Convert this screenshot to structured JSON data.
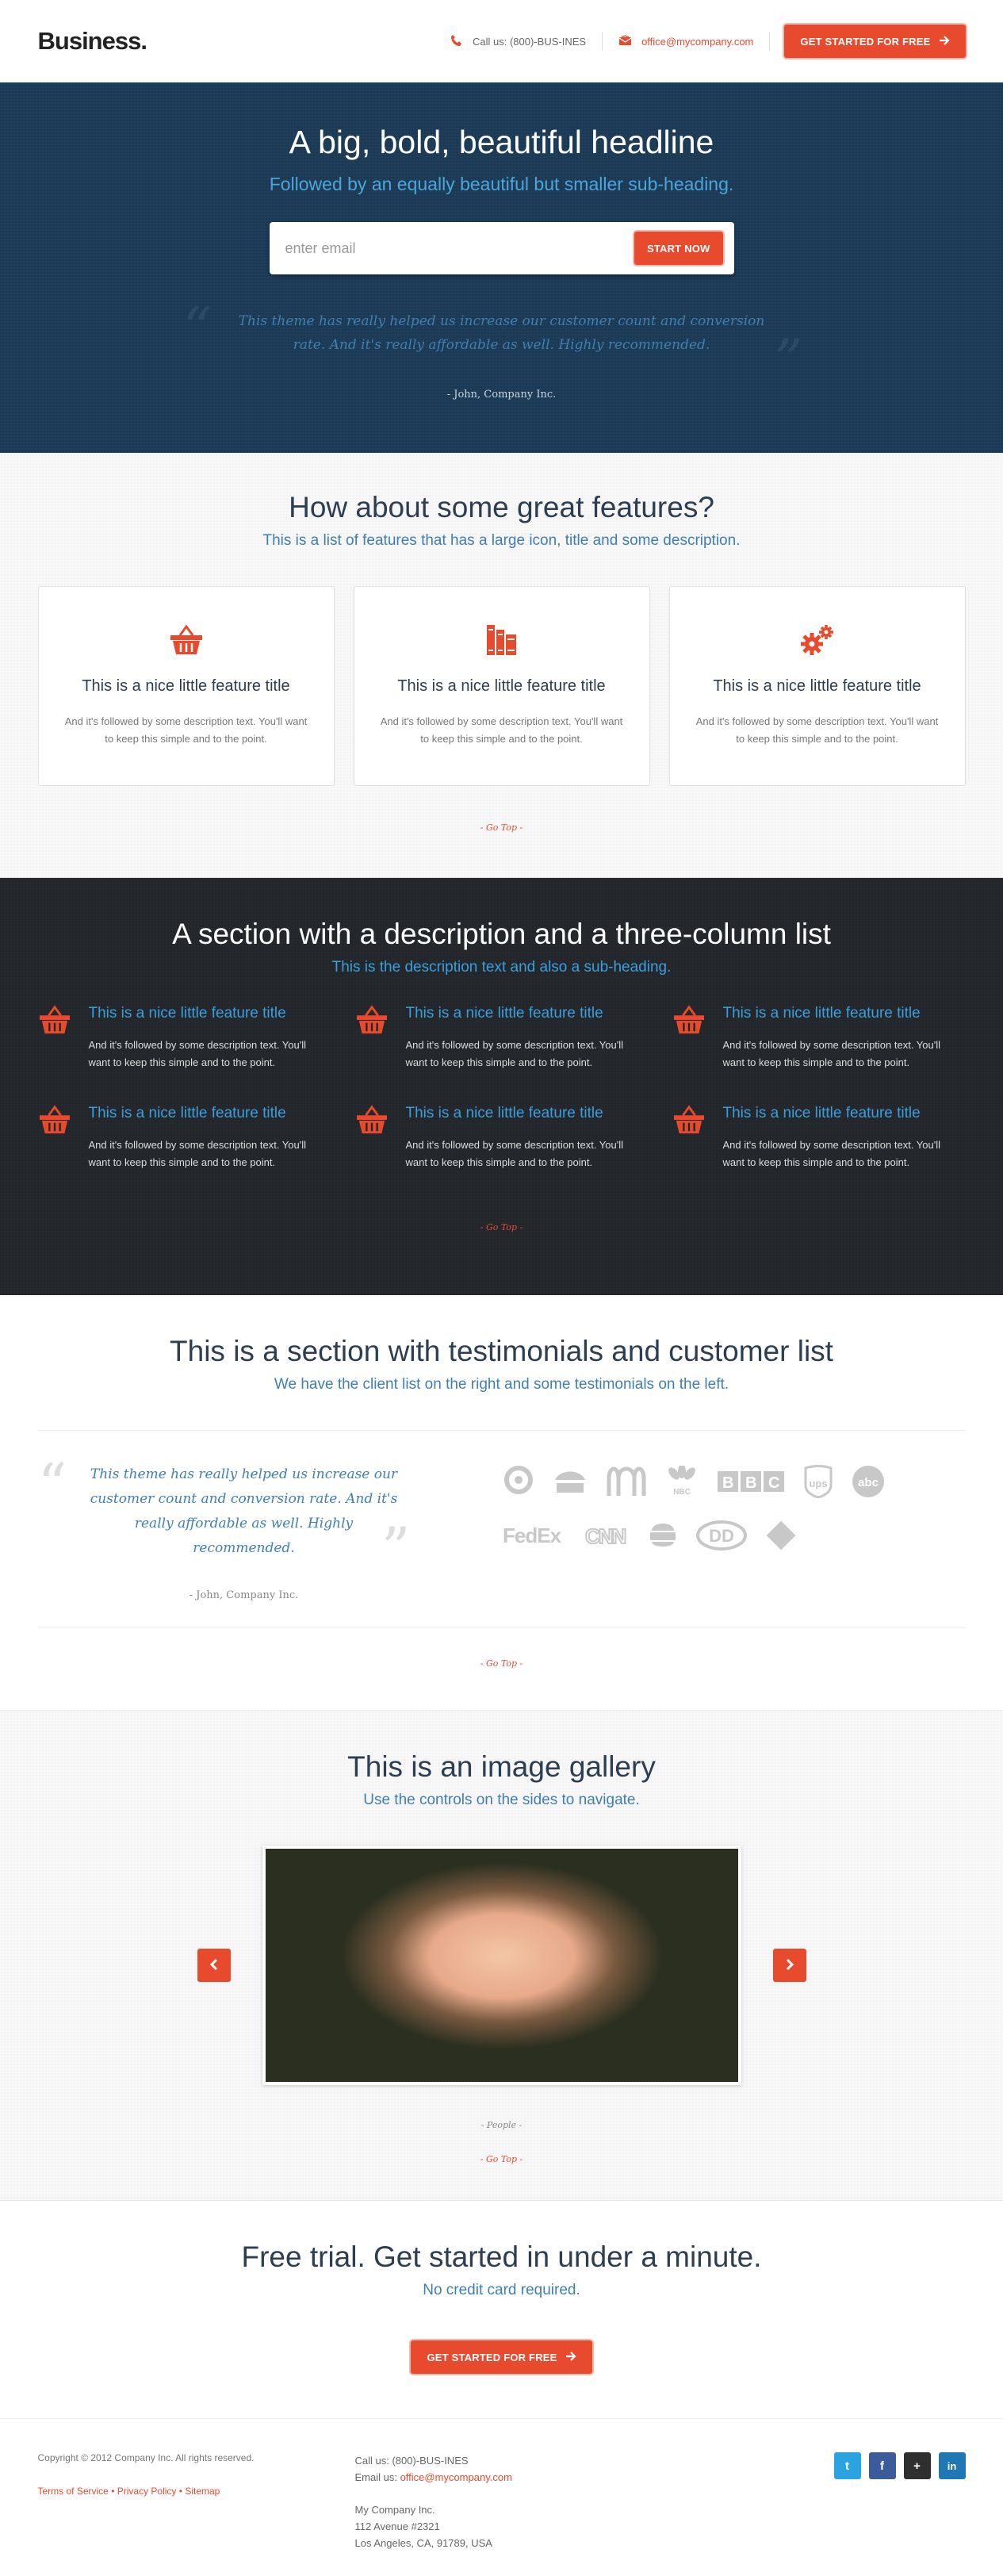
{
  "header": {
    "logo": "Business.",
    "phone": "Call us: (800)-BUS-INES",
    "email": "office@mycompany.com",
    "cta": "GET STARTED FOR FREE",
    "phone_icon": "phone-icon",
    "email_icon": "envelope-icon",
    "cta_icon": "arrow-right-icon"
  },
  "hero": {
    "title": "A big, bold, beautiful headline",
    "subtitle": "Followed by an equally beautiful but smaller sub-heading.",
    "email_placeholder": "enter email",
    "button": "START NOW",
    "quote": "This theme has really helped us increase our customer count and conversion rate. And it's really affordable as well. Highly recommended.",
    "author": "- John, Company Inc."
  },
  "features": {
    "title": "How about some great features?",
    "subtitle": "This is a list of features that has a large icon, title and some description.",
    "cards": [
      {
        "icon": "basket-icon",
        "title": "This is a nice little feature title",
        "text": "And it's followed by some description text. You'll want to keep this simple and to the point."
      },
      {
        "icon": "books-icon",
        "title": "This is a nice little feature title",
        "text": "And it's followed by some description text. You'll want to keep this simple and to the point."
      },
      {
        "icon": "gears-icon",
        "title": "This is a nice little feature title",
        "text": "And it's followed by some description text. You'll want to keep this simple and to the point."
      }
    ],
    "gotop": "- Go Top -"
  },
  "threecol": {
    "title": "A section with a description and a three-column list",
    "subtitle": "This is the description text and also a sub-heading.",
    "items": [
      {
        "title": "This is a nice little feature title",
        "text": "And it's followed by some description text. You'll want to keep this simple and to the point."
      },
      {
        "title": "This is a nice little feature title",
        "text": "And it's followed by some description text. You'll want to keep this simple and to the point."
      },
      {
        "title": "This is a nice little feature title",
        "text": "And it's followed by some description text. You'll want to keep this simple and to the point."
      },
      {
        "title": "This is a nice little feature title",
        "text": "And it's followed by some description text. You'll want to keep this simple and to the point."
      },
      {
        "title": "This is a nice little feature title",
        "text": "And it's followed by some description text. You'll want to keep this simple and to the point."
      },
      {
        "title": "This is a nice little feature title",
        "text": "And it's followed by some description text. You'll want to keep this simple and to the point."
      }
    ],
    "icon": "basket-icon",
    "gotop": "- Go Top -"
  },
  "testimonials": {
    "title": "This is a section with testimonials and customer list",
    "subtitle": "We have the client list on the right and some testimonials on the left.",
    "quote": "This theme has really helped us increase our customer count and conversion rate. And it's really affordable as well. Highly recommended.",
    "author": "- John, Company Inc.",
    "logos": [
      "TARGET",
      "Pizza Hut",
      "McDonald's",
      "NBC",
      "BBC",
      "UPS",
      "abc",
      "FedEx",
      "CNN",
      "Burger King",
      "DD",
      "Diamond"
    ],
    "gotop": "- Go Top -"
  },
  "gallery": {
    "title": "This is an image gallery",
    "subtitle": "Use the controls on the sides to navigate.",
    "caption": "- People -",
    "prev_icon": "chevron-left-icon",
    "next_icon": "chevron-right-icon",
    "gotop": "- Go Top -"
  },
  "cta": {
    "title": "Free trial. Get started in under a minute.",
    "subtitle": "No credit card required.",
    "button": "GET STARTED FOR FREE"
  },
  "footer": {
    "copyright": "Copyright © 2012 Company Inc. All rights reserved.",
    "links": [
      "Terms of Service",
      "Privacy Policy",
      "Sitemap"
    ],
    "call": "Call us: (800)-BUS-INES",
    "email_label": "Email us: ",
    "email": "office@mycompany.com",
    "company": "My Company Inc.",
    "street": "112 Avenue #2321",
    "city": "Los Angeles, CA, 91789, USA",
    "social": [
      {
        "name": "twitter-icon",
        "glyph": "t",
        "color": "#2aa3e0"
      },
      {
        "name": "facebook-icon",
        "glyph": "f",
        "color": "#3b5b9a"
      },
      {
        "name": "google-plus-icon",
        "glyph": "+",
        "color": "#2f2f2f"
      },
      {
        "name": "linkedin-icon",
        "glyph": "in",
        "color": "#1f78b4"
      }
    ]
  },
  "colors": {
    "accent": "#e84a2e",
    "hero_bg": "#1c3a55",
    "dark_bg": "#23272b",
    "link_blue": "#3f7fb1"
  }
}
